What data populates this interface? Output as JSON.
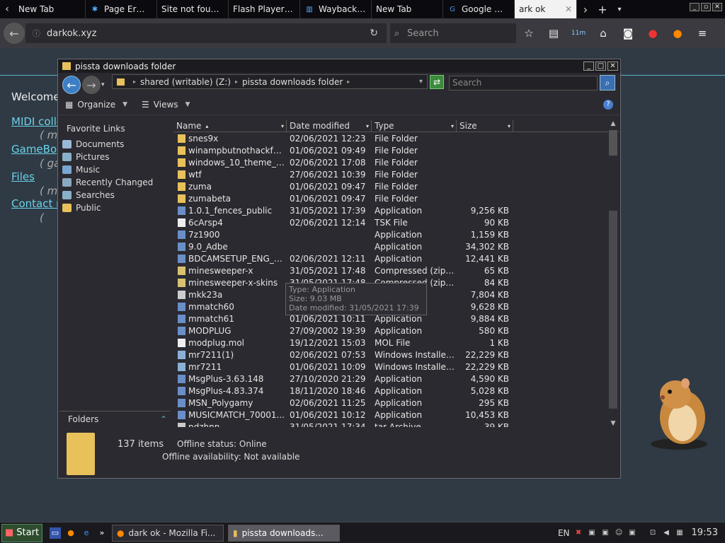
{
  "browser": {
    "tabs": [
      {
        "label": "New Tab",
        "icon": "none"
      },
      {
        "label": "Page Er…",
        "icon": "page-error-icon"
      },
      {
        "label": "Site not fou…",
        "icon": "none"
      },
      {
        "label": "Flash Player…",
        "icon": "none"
      },
      {
        "label": "Wayback…",
        "icon": "wayback-icon"
      },
      {
        "label": "New Tab",
        "icon": "none"
      },
      {
        "label": "Google …",
        "icon": "google-icon"
      },
      {
        "label": "ark ok",
        "icon": "none"
      }
    ],
    "url": "darkok.xyz",
    "search_placeholder": "Search"
  },
  "page": {
    "welcome": "Welcome",
    "links": [
      {
        "label": "MIDI colle",
        "sub": "( m"
      },
      {
        "label": "GameBo",
        "sub": "( ga"
      },
      {
        "label": "Files",
        "sub": "( m"
      },
      {
        "label": "Contact r",
        "sub": "("
      }
    ]
  },
  "explorer": {
    "title": "pissta downloads folder",
    "address": {
      "drive": "shared (writable) (Z:)",
      "folder": "pissta downloads folder"
    },
    "search_placeholder": "Search",
    "commands": {
      "organize": "Organize",
      "views": "Views"
    },
    "nav_header": "Favorite Links",
    "nav_items": [
      {
        "label": "Documents",
        "color": "#9ab8d8"
      },
      {
        "label": "Pictures",
        "color": "#8ab0c8"
      },
      {
        "label": "Music",
        "color": "#7aa6d0"
      },
      {
        "label": "Recently Changed",
        "color": "#8aa8c0"
      },
      {
        "label": "Searches",
        "color": "#8ab0c8"
      },
      {
        "label": "Public",
        "color": "#e8c15a"
      }
    ],
    "folders_label": "Folders",
    "columns": {
      "name": "Name",
      "date": "Date modified",
      "type": "Type",
      "size": "Size"
    },
    "files": [
      {
        "name": "snes9x",
        "date": "02/06/2021 12:23",
        "type": "File Folder",
        "size": "",
        "icon": "folder"
      },
      {
        "name": "winampbutnothackfuc...",
        "date": "01/06/2021 09:49",
        "type": "File Folder",
        "size": "",
        "icon": "folder"
      },
      {
        "name": "windows_10_theme_for...",
        "date": "02/06/2021 17:08",
        "type": "File Folder",
        "size": "",
        "icon": "folder"
      },
      {
        "name": "wtf",
        "date": "27/06/2021 10:39",
        "type": "File Folder",
        "size": "",
        "icon": "folder"
      },
      {
        "name": "zuma",
        "date": "01/06/2021 09:47",
        "type": "File Folder",
        "size": "",
        "icon": "folder"
      },
      {
        "name": "zumabeta",
        "date": "01/06/2021 09:47",
        "type": "File Folder",
        "size": "",
        "icon": "folder"
      },
      {
        "name": "1.0.1_fences_public",
        "date": "31/05/2021 17:39",
        "type": "Application",
        "size": "9,256 KB",
        "icon": "app"
      },
      {
        "name": "6cArsp4",
        "date": "02/06/2021 12:14",
        "type": "TSK File",
        "size": "90 KB",
        "icon": "file"
      },
      {
        "name": "7z1900",
        "date": "",
        "type": "Application",
        "size": "1,159 KB",
        "icon": "app"
      },
      {
        "name": "9.0_Adbe",
        "date": "",
        "type": "Application",
        "size": "34,302 KB",
        "icon": "app"
      },
      {
        "name": "BDCAMSETUP_ENG_2...",
        "date": "02/06/2021 12:11",
        "type": "Application",
        "size": "12,441 KB",
        "icon": "app"
      },
      {
        "name": "minesweeper-x",
        "date": "31/05/2021 17:48",
        "type": "Compressed (zipp...",
        "size": "65 KB",
        "icon": "zip"
      },
      {
        "name": "minesweeper-x-skins",
        "date": "31/05/2021 17:48",
        "type": "Compressed (zipp...",
        "size": "84 KB",
        "icon": "zip"
      },
      {
        "name": "mkk23a",
        "date": "31/05/2021 17:33",
        "type": "7z Archive",
        "size": "7,804 KB",
        "icon": "archive"
      },
      {
        "name": "mmatch60",
        "date": "01/06/2021 10:11",
        "type": "Application",
        "size": "9,628 KB",
        "icon": "app"
      },
      {
        "name": "mmatch61",
        "date": "01/06/2021 10:11",
        "type": "Application",
        "size": "9,884 KB",
        "icon": "app"
      },
      {
        "name": "MODPLUG",
        "date": "27/09/2002 19:39",
        "type": "Application",
        "size": "580 KB",
        "icon": "app"
      },
      {
        "name": "modplug.mol",
        "date": "19/12/2021 15:03",
        "type": "MOL File",
        "size": "1 KB",
        "icon": "file"
      },
      {
        "name": "mr7211(1)",
        "date": "02/06/2021 07:53",
        "type": "Windows Installer...",
        "size": "22,229 KB",
        "icon": "installer"
      },
      {
        "name": "mr7211",
        "date": "01/06/2021 10:09",
        "type": "Windows Installer...",
        "size": "22,229 KB",
        "icon": "installer"
      },
      {
        "name": "MsgPlus-3.63.148",
        "date": "27/10/2020 21:29",
        "type": "Application",
        "size": "4,590 KB",
        "icon": "app"
      },
      {
        "name": "MsgPlus-4.83.374",
        "date": "18/11/2020 18:46",
        "type": "Application",
        "size": "5,028 KB",
        "icon": "app"
      },
      {
        "name": "MSN_Polygamy",
        "date": "02/06/2021 11:25",
        "type": "Application",
        "size": "295 KB",
        "icon": "app"
      },
      {
        "name": "MUSICMATCH_70001...",
        "date": "01/06/2021 10:12",
        "type": "Application",
        "size": "10,453 KB",
        "icon": "app"
      },
      {
        "name": "pdzhnn",
        "date": "31/05/2021 17:34",
        "type": "tar Archive",
        "size": "39 KB",
        "icon": "archive"
      }
    ],
    "tooltip": {
      "type": "Type: Application",
      "size": "Size: 9.03 MB",
      "date": "Date modified: 31/05/2021 17:39"
    },
    "item_count": "137 items",
    "offline_status": "Offline status: Online",
    "offline_availability": "Offline availability: Not available"
  },
  "taskbar": {
    "start": "Start",
    "tasks": [
      {
        "label": "dark ok - Mozilla Fi...",
        "active": false
      },
      {
        "label": "pissta downloads...",
        "active": true
      }
    ],
    "lang": "EN",
    "clock": "19:53"
  },
  "colors": {
    "accent": "#6ad2e8",
    "folder": "#e8c15a"
  }
}
